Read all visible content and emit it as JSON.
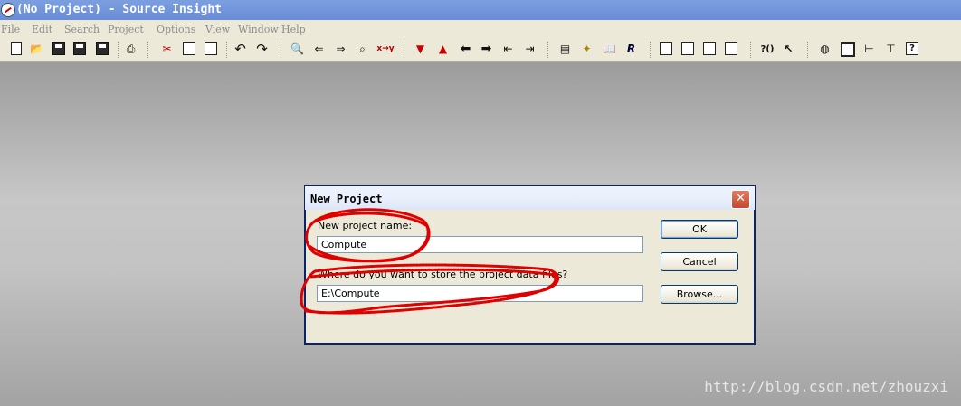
{
  "window": {
    "title": "(No Project) - Source Insight"
  },
  "menu": [
    "File",
    "Edit",
    "Search",
    "Project",
    "Options",
    "View",
    "Window",
    "Help"
  ],
  "toolbar": {
    "find_replace_label": "x→y",
    "parens_label": "?()",
    "help_label": "?"
  },
  "dialog": {
    "title": "New Project",
    "close_label": "✕",
    "name_label": "New project name:",
    "name_value": "Compute",
    "location_label": "Where do you want to store the project data files?",
    "location_value": "E:\\Compute",
    "ok_label": "OK",
    "cancel_label": "Cancel",
    "browse_label": "Browse..."
  },
  "watermark": "http://blog.csdn.net/zhouzxi",
  "colors": {
    "titlebar": "#7c9fe0",
    "dialog_bg": "#ece9d8",
    "scribble": "#e00000",
    "close": "#d0573b"
  }
}
